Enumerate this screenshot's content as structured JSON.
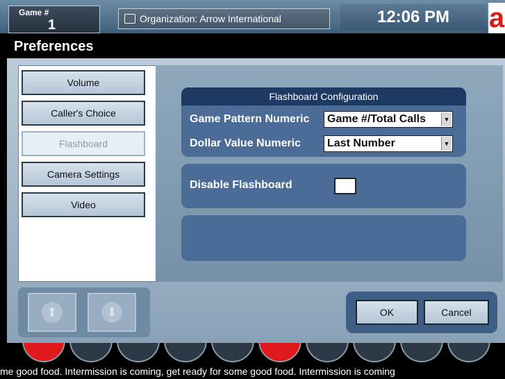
{
  "header": {
    "game_label": "Game #",
    "game_number": "1",
    "organization": "Organization: Arrow International",
    "time": "12:06 PM",
    "logo_letter": "a"
  },
  "window": {
    "title": "Preferences"
  },
  "nav": {
    "items": [
      {
        "label": "Volume",
        "selected": false
      },
      {
        "label": "Caller's Choice",
        "selected": false
      },
      {
        "label": "Flashboard",
        "selected": true
      },
      {
        "label": "Camera Settings",
        "selected": false
      },
      {
        "label": "Video",
        "selected": false
      }
    ]
  },
  "flashboard": {
    "section_title": "Flashboard Configuration",
    "game_pattern_label": "Game Pattern Numeric",
    "game_pattern_value": "Game #/Total Calls",
    "dollar_value_label": "Dollar Value Numeric",
    "dollar_value_value": "Last Number",
    "disable_label": "Disable Flashboard",
    "disable_checked": false
  },
  "buttons": {
    "ok": "OK",
    "cancel": "Cancel"
  },
  "ticker": {
    "text": "me good food.     Intermission is coming, get ready for some good food.     Intermission is coming"
  },
  "colors": {
    "ball_red": "#e01a1a",
    "ball_dark": "#2b3a46",
    "panel_dark": "#1e3a62",
    "accent": "#4a6c96"
  }
}
